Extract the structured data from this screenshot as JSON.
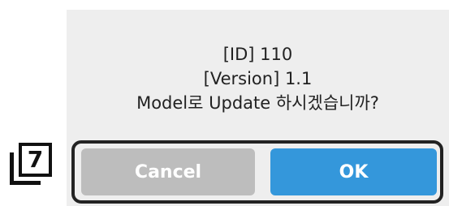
{
  "dialog": {
    "message_lines": [
      "[ID] 110",
      "[Version] 1.1",
      "Model로 Update 하시겠습니까?"
    ],
    "cancel_label": "Cancel",
    "ok_label": "OK"
  },
  "annotation": {
    "step_number": "7"
  },
  "colors": {
    "dialog_bg": "#eeeeee",
    "cancel_bg": "#bdbdbd",
    "ok_bg": "#3497db",
    "highlight_border": "#222222"
  }
}
